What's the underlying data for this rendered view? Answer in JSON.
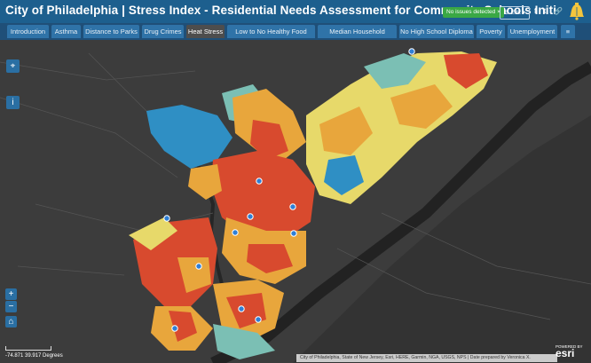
{
  "header": {
    "title": "City of Philadelphia | Stress Index - Residential Needs Assessment for Community Schools Initi",
    "issues_badge": "No issues detected ×",
    "edit_label": "⚙ Edit ▾",
    "colors": {
      "bar": "#1d5f8e",
      "badge": "#3aa845"
    }
  },
  "tabs": [
    {
      "label": "Introduction"
    },
    {
      "label": "Asthma"
    },
    {
      "label": "Distance to Parks"
    },
    {
      "label": "Drug Crimes"
    },
    {
      "label": "Heat Stress",
      "active": true
    },
    {
      "label": "Low to No Healthy Food Access"
    },
    {
      "label": "Median Household Income"
    },
    {
      "label": "No High School Diploma"
    },
    {
      "label": "Poverty"
    },
    {
      "label": "Unemployment"
    },
    {
      "label": "≡"
    }
  ],
  "map": {
    "legend_colors": [
      "#2f8fc4",
      "#7bbfb4",
      "#e7d96a",
      "#e8a63c",
      "#d84a2e"
    ],
    "coordinates": "-74.871 39.917 Degrees",
    "attribution": "City of Philadelphia, State of New Jersey, Esri, HERE, Garmin, NGA, USGS, NPS | Date prepared by Veronica X.",
    "logo_small": "POWERED BY",
    "logo": "esri"
  }
}
